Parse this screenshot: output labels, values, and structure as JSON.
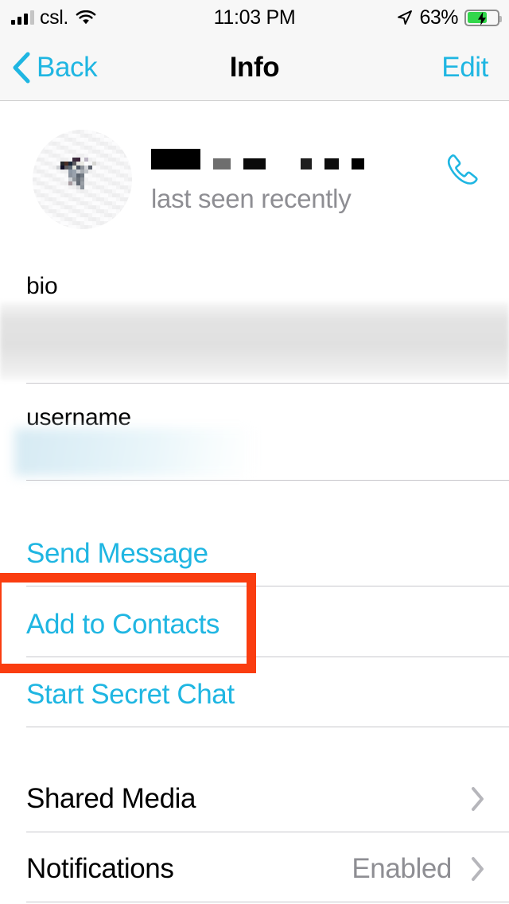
{
  "status_bar": {
    "carrier": "csl.",
    "time": "11:03 PM",
    "battery_percent": "63%",
    "signal_icon": "signal-bars-icon",
    "wifi_icon": "wifi-icon",
    "location_icon": "location-arrow-icon",
    "battery_icon": "battery-charging-icon",
    "battery_fill_color": "#32D74B"
  },
  "nav_bar": {
    "back_label": "Back",
    "title": "Info",
    "edit_label": "Edit",
    "accent_color": "#1FB6E2",
    "background_color": "#F7F7F7"
  },
  "profile": {
    "avatar_state": "pixelated-redacted",
    "name": "",
    "name_state": "redacted",
    "status": "last seen recently",
    "call_button_label": "call-button"
  },
  "bio_section": {
    "label": "bio",
    "value": "",
    "value_state": "blurred"
  },
  "username_section": {
    "label": "username",
    "value": "",
    "value_state": "blurred"
  },
  "actions": [
    {
      "label": "Send Message",
      "name": "send-message-button"
    },
    {
      "label": "Add to Contacts",
      "name": "add-to-contacts-button"
    },
    {
      "label": "Start Secret Chat",
      "name": "start-secret-chat-button"
    }
  ],
  "settings_rows": [
    {
      "label": "Shared Media",
      "value": "",
      "name": "shared-media-row"
    },
    {
      "label": "Notifications",
      "value": "Enabled",
      "name": "notifications-row"
    }
  ],
  "annotation": {
    "type": "highlight-box",
    "target": "Add to Contacts",
    "color": "#FA3D10"
  }
}
